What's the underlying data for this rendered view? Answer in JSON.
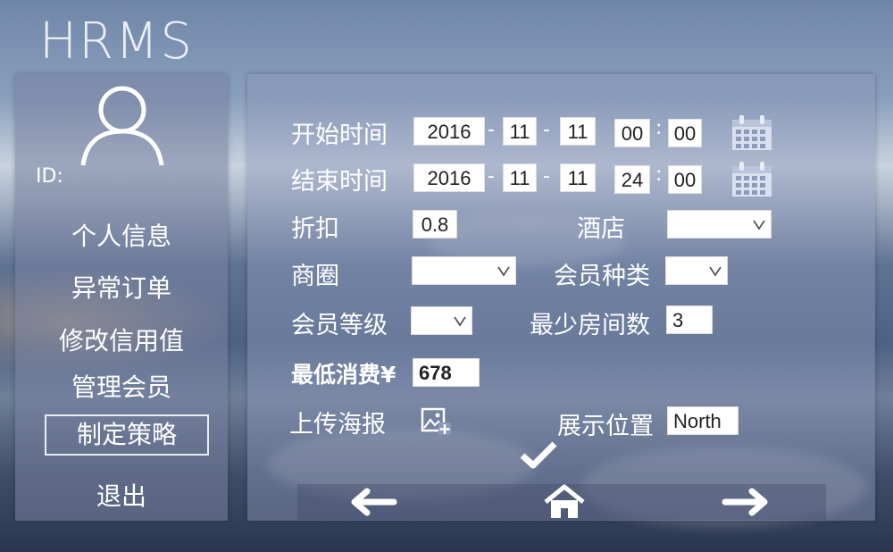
{
  "app": {
    "title": "HRMS"
  },
  "user": {
    "id_label": "ID:"
  },
  "sidebar": {
    "items": [
      {
        "label": "个人信息"
      },
      {
        "label": "异常订单"
      },
      {
        "label": "修改信用值"
      },
      {
        "label": "管理会员"
      },
      {
        "label": "制定策略",
        "active": true
      },
      {
        "label": "退出"
      }
    ]
  },
  "form": {
    "start": {
      "label": "开始时间",
      "year": "2016",
      "month": "11",
      "day": "11",
      "hour": "00",
      "minute": "00"
    },
    "end": {
      "label": "结束时间",
      "year": "2016",
      "month": "11",
      "day": "11",
      "hour": "24",
      "minute": "00"
    },
    "discount": {
      "label": "折扣",
      "value": "0.8"
    },
    "hotel": {
      "label": "酒店",
      "value": ""
    },
    "business_area": {
      "label": "商圈",
      "value": ""
    },
    "member_type": {
      "label": "会员种类",
      "value": ""
    },
    "member_level": {
      "label": "会员等级",
      "value": ""
    },
    "min_rooms": {
      "label": "最少房间数",
      "value": "3"
    },
    "min_spend": {
      "label": "最低消费¥",
      "value": "678"
    },
    "upload_poster": {
      "label": "上传海报"
    },
    "display_position": {
      "label": "展示位置",
      "value": "North"
    },
    "sep_dash": "-",
    "sep_colon": ":"
  },
  "colors": {
    "panel_bg": "#8c96b9",
    "accent": "#ffffff"
  },
  "icons": [
    "user-avatar-icon",
    "calendar-icon",
    "chevron-down-icon",
    "image-upload-icon",
    "check-icon",
    "arrow-left-icon",
    "home-icon",
    "arrow-right-icon"
  ]
}
